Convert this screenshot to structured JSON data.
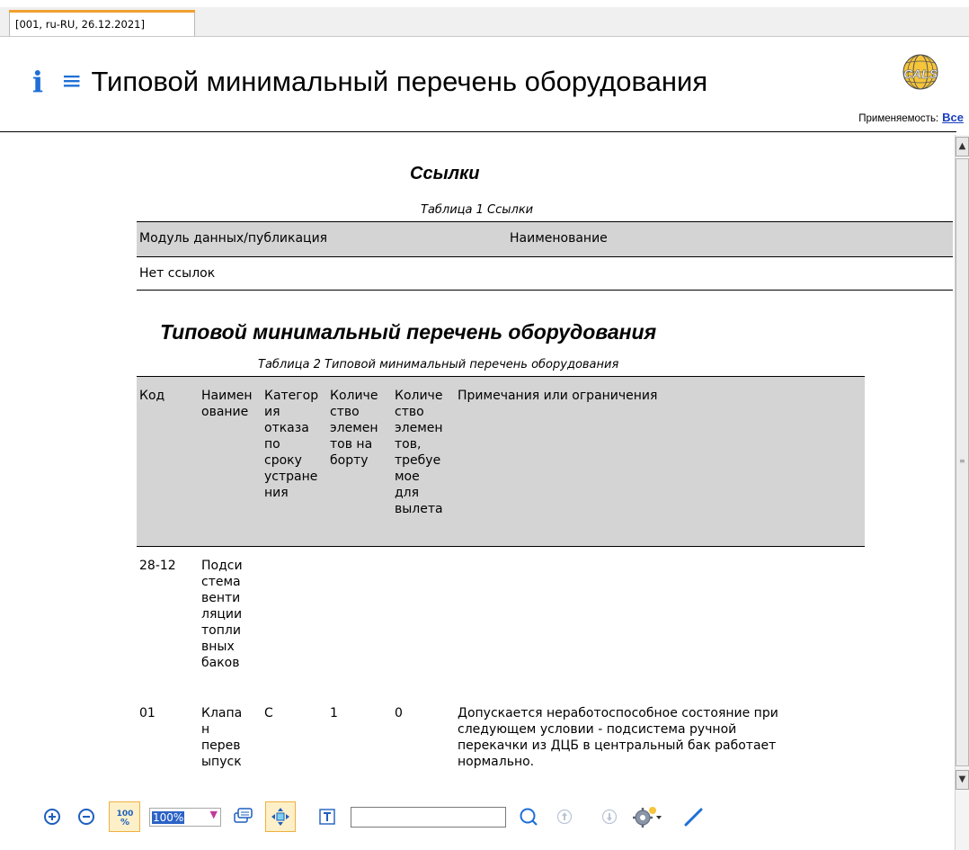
{
  "tab": {
    "label": "[001, ru-RU, 26.12.2021]"
  },
  "header": {
    "title": "Типовой минимальный перечень оборудования",
    "applicability_label": "Применяемость:",
    "applicability_link": "Все",
    "logo_text": "CALS"
  },
  "section1": {
    "title": "Ссылки",
    "caption": "Таблица 1   Ссылки",
    "columns": [
      "Модуль данных/публикация",
      "Наименование"
    ],
    "rows": [
      [
        "Нет ссылок"
      ]
    ]
  },
  "section2": {
    "title": "Типовой минимальный перечень оборудования",
    "caption": "Таблица 2   Типовой минимальный перечень оборудования",
    "columns": [
      "Код",
      "Наимен\nование",
      "Категор\nия\nотказа\nпо\nсроку\nустране\nния",
      "Количе\nство\nэлемен\nтов на\nборту",
      "Количе\nство\nэлемен\nтов,\nтребуе\nмое\nдля\nвылета",
      "Примечания или ограничения"
    ],
    "rows": [
      {
        "code": "28-12",
        "name": "Подси\nстема\nвенти\nляции\nтопли\nвных\nбаков",
        "category": "",
        "onboard": "",
        "required": "",
        "notes": ""
      },
      {
        "code": "01",
        "name": "Клапа\nн\nперев\nыпуск",
        "category": "C",
        "onboard": "1",
        "required": "0",
        "notes": "Допускается неработоспособное состояние при\nследующем условии - подсистема ручной\nперекачки из ДЦБ в центральный бак работает\nнормально."
      }
    ]
  },
  "toolbar": {
    "zoom_value": "100%",
    "search_placeholder": ""
  },
  "colors": {
    "accent": "#1e6fd6",
    "header_fill": "#d4d4d4",
    "active_button": "#fdf0c8"
  }
}
